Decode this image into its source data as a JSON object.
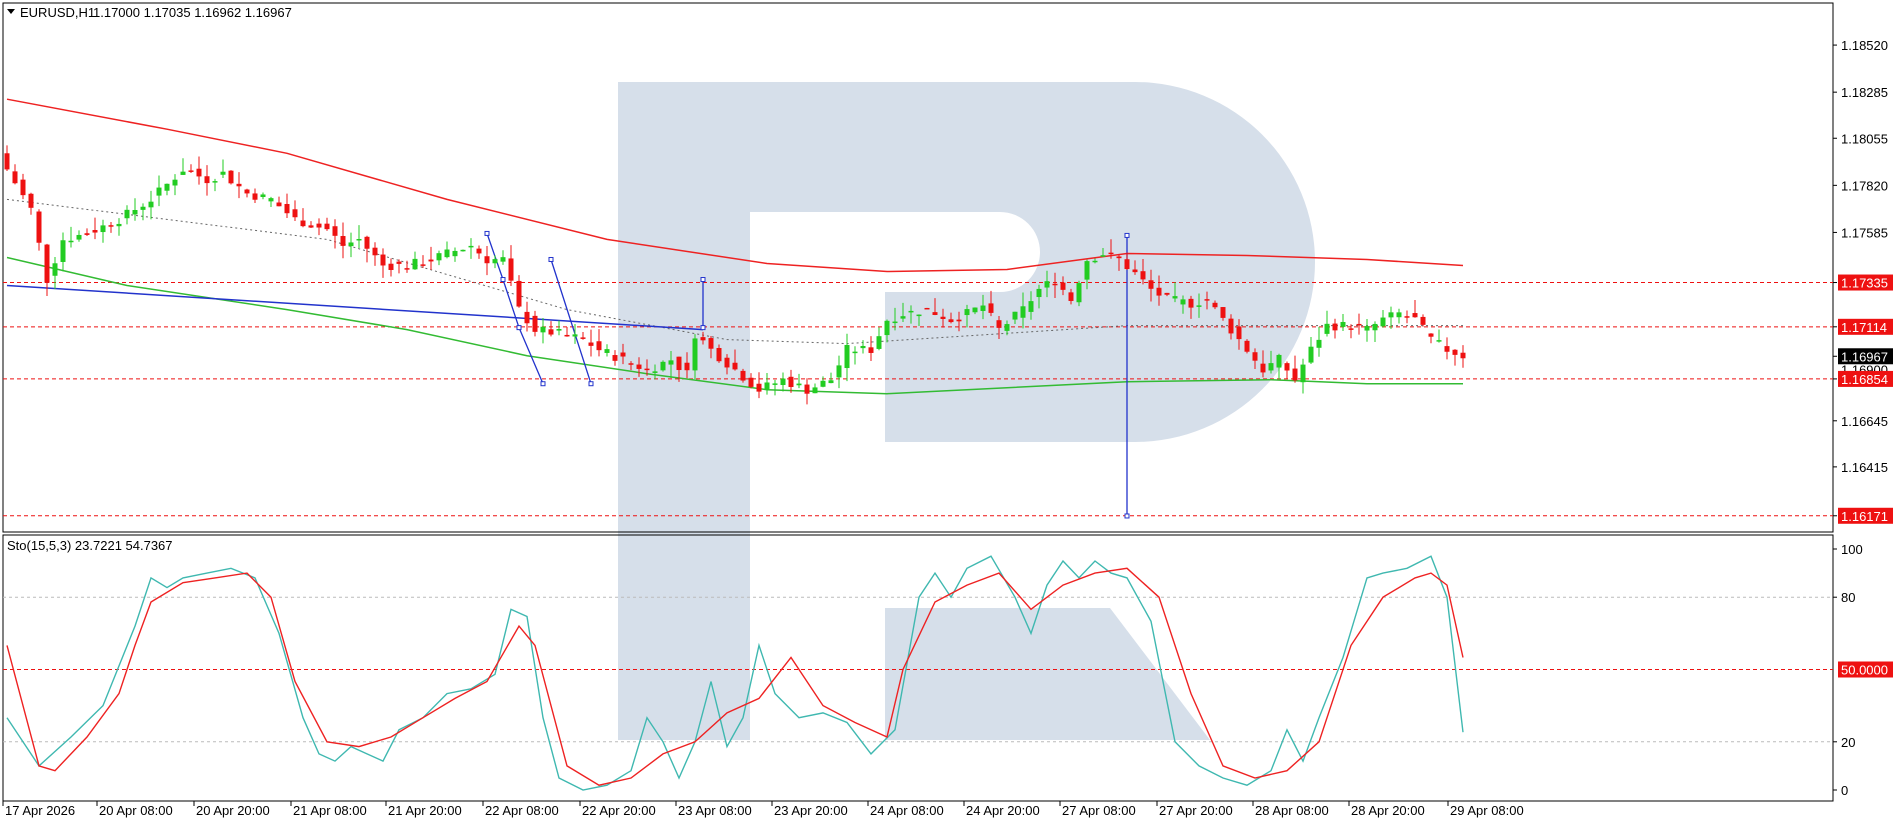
{
  "header": {
    "symbol": "EURUSD,H1",
    "ohlc": "1.17000 1.17035 1.16962 1.16967"
  },
  "stoch_header": "Sto(15,5,3) 23.7221 54.7367",
  "colors": {
    "bull": "#22cc22",
    "bear": "#ee1111",
    "ma_slow": "#ee2222",
    "ma_fast": "#33bb33",
    "trend_blue": "#2233cc",
    "stoch_main": "#3fb8b0",
    "stoch_signal": "#ee2222",
    "level_red": "#ee1111",
    "watermark": "#d6dfea"
  },
  "chart_data": [
    {
      "type": "candlestick",
      "title": "EURUSD,H1",
      "y_ticks": [
        "1.18520",
        "1.18285",
        "1.18055",
        "1.17820",
        "1.17585",
        "1.17335",
        "1.17114",
        "1.16967",
        "1.16854",
        "1.16645",
        "1.16415",
        "1.16171"
      ],
      "x_ticks": [
        "17 Apr 2026",
        "20 Apr 08:00",
        "20 Apr 20:00",
        "21 Apr 08:00",
        "21 Apr 20:00",
        "22 Apr 08:00",
        "22 Apr 20:00",
        "23 Apr 08:00",
        "23 Apr 20:00",
        "24 Apr 08:00",
        "24 Apr 20:00",
        "27 Apr 08:00",
        "27 Apr 20:00",
        "28 Apr 08:00",
        "28 Apr 20:00",
        "29 Apr 08:00"
      ],
      "hidden_tick": "1.16900",
      "ylim": [
        1.161,
        1.1872
      ],
      "price_levels": [
        {
          "value": 1.17335,
          "label": "1.17335"
        },
        {
          "value": 1.17114,
          "label": "1.17114"
        },
        {
          "value": 1.16854,
          "label": "1.16854"
        },
        {
          "value": 1.16171,
          "label": "1.16171"
        }
      ],
      "current_price": {
        "value": 1.16967,
        "label": "1.16967"
      },
      "close_path": [
        [
          0,
          1.179
        ],
        [
          3,
          1.177
        ],
        [
          5,
          1.1735
        ],
        [
          7,
          1.1755
        ],
        [
          10,
          1.1758
        ],
        [
          14,
          1.1765
        ],
        [
          18,
          1.1775
        ],
        [
          22,
          1.179
        ],
        [
          25,
          1.1785
        ],
        [
          27,
          1.1788
        ],
        [
          30,
          1.1778
        ],
        [
          33,
          1.1775
        ],
        [
          36,
          1.1765
        ],
        [
          40,
          1.176
        ],
        [
          42,
          1.1752
        ],
        [
          44,
          1.1755
        ],
        [
          47,
          1.1742
        ],
        [
          50,
          1.1742
        ],
        [
          53,
          1.1745
        ],
        [
          55,
          1.1748
        ],
        [
          58,
          1.1752
        ],
        [
          60,
          1.1745
        ],
        [
          62,
          1.1745
        ],
        [
          64,
          1.172
        ],
        [
          66,
          1.171
        ],
        [
          69,
          1.1708
        ],
        [
          72,
          1.1705
        ],
        [
          74,
          1.17
        ],
        [
          77,
          1.1695
        ],
        [
          80,
          1.169
        ],
        [
          83,
          1.1695
        ],
        [
          85,
          1.1688
        ],
        [
          86,
          1.1708
        ],
        [
          88,
          1.17
        ],
        [
          91,
          1.169
        ],
        [
          94,
          1.168
        ],
        [
          97,
          1.1685
        ],
        [
          100,
          1.168
        ],
        [
          103,
          1.1685
        ],
        [
          105,
          1.17
        ],
        [
          108,
          1.17
        ],
        [
          110,
          1.1715
        ],
        [
          112,
          1.1718
        ],
        [
          115,
          1.172
        ],
        [
          118,
          1.1715
        ],
        [
          120,
          1.1718
        ],
        [
          122,
          1.1722
        ],
        [
          124,
          1.171
        ],
        [
          127,
          1.172
        ],
        [
          129,
          1.173
        ],
        [
          131,
          1.1735
        ],
        [
          133,
          1.1725
        ],
        [
          135,
          1.1745
        ],
        [
          137,
          1.1748
        ],
        [
          139,
          1.1745
        ],
        [
          141,
          1.1738
        ],
        [
          143,
          1.173
        ],
        [
          145,
          1.1725
        ],
        [
          148,
          1.1723
        ],
        [
          150,
          1.1725
        ],
        [
          151,
          1.172
        ],
        [
          153,
          1.171
        ],
        [
          155,
          1.17
        ],
        [
          157,
          1.169
        ],
        [
          159,
          1.1695
        ],
        [
          161,
          1.1685
        ],
        [
          163,
          1.17
        ],
        [
          165,
          1.1712
        ],
        [
          168,
          1.1712
        ],
        [
          170,
          1.171
        ],
        [
          172,
          1.1715
        ],
        [
          174,
          1.1718
        ],
        [
          176,
          1.1715
        ],
        [
          178,
          1.1705
        ],
        [
          180,
          1.17
        ],
        [
          182,
          1.1697
        ]
      ],
      "series": [
        {
          "name": "ma_slow",
          "points": [
            [
              0,
              1.1825
            ],
            [
              20,
              1.181
            ],
            [
              35,
              1.1798
            ],
            [
              55,
              1.1775
            ],
            [
              75,
              1.1755
            ],
            [
              95,
              1.1743
            ],
            [
              110,
              1.1739
            ],
            [
              125,
              1.174
            ],
            [
              140,
              1.1748
            ],
            [
              155,
              1.1747
            ],
            [
              170,
              1.1745
            ],
            [
              182,
              1.1742
            ]
          ]
        },
        {
          "name": "ma_fast",
          "points": [
            [
              0,
              1.1746
            ],
            [
              15,
              1.1732
            ],
            [
              35,
              1.172
            ],
            [
              50,
              1.171
            ],
            [
              65,
              1.1697
            ],
            [
              80,
              1.1688
            ],
            [
              95,
              1.168
            ],
            [
              110,
              1.1678
            ],
            [
              125,
              1.1681
            ],
            [
              140,
              1.1684
            ],
            [
              158,
              1.1685
            ],
            [
              170,
              1.1683
            ],
            [
              182,
              1.1683
            ]
          ]
        },
        {
          "name": "dotted_trend",
          "points": [
            [
              0,
              1.1775
            ],
            [
              40,
              1.1755
            ],
            [
              70,
              1.172
            ],
            [
              90,
              1.1705
            ],
            [
              105,
              1.1703
            ],
            [
              140,
              1.1712
            ],
            [
              182,
              1.1712
            ]
          ]
        },
        {
          "name": "blue_trend",
          "points": [
            [
              0,
              1.1732
            ],
            [
              87,
              1.171
            ]
          ]
        },
        {
          "name": "blue_zigzag",
          "points": [
            [
              60,
              1.1758
            ],
            [
              62,
              1.1735
            ],
            [
              64,
              1.1711
            ],
            [
              67,
              1.1683
            ]
          ]
        },
        {
          "name": "blue_zigzag_2",
          "points": [
            [
              68,
              1.1745
            ],
            [
              73,
              1.1683
            ]
          ]
        },
        {
          "name": "blue_vertical_1",
          "points": [
            [
              87,
              1.1735
            ],
            [
              87,
              1.1711
            ]
          ]
        },
        {
          "name": "blue_vertical_2",
          "points": [
            [
              140,
              1.1757
            ],
            [
              140,
              1.1617
            ]
          ]
        }
      ]
    },
    {
      "type": "line",
      "title": "Sto(15,5,3) 23.7221 54.7367",
      "y_ticks": [
        "100",
        "80",
        "20",
        "0"
      ],
      "levels": [
        {
          "value": 50,
          "label": "50.0000"
        }
      ],
      "ylim": [
        0,
        100
      ],
      "series": [
        {
          "name": "main",
          "points": [
            [
              0,
              30
            ],
            [
              4,
              10
            ],
            [
              8,
              22
            ],
            [
              12,
              35
            ],
            [
              16,
              68
            ],
            [
              18,
              88
            ],
            [
              20,
              84
            ],
            [
              22,
              88
            ],
            [
              25,
              90
            ],
            [
              28,
              92
            ],
            [
              31,
              88
            ],
            [
              34,
              65
            ],
            [
              37,
              30
            ],
            [
              39,
              15
            ],
            [
              41,
              12
            ],
            [
              43,
              18
            ],
            [
              45,
              15
            ],
            [
              47,
              12
            ],
            [
              49,
              25
            ],
            [
              52,
              30
            ],
            [
              55,
              40
            ],
            [
              58,
              42
            ],
            [
              61,
              48
            ],
            [
              63,
              75
            ],
            [
              65,
              72
            ],
            [
              67,
              30
            ],
            [
              69,
              5
            ],
            [
              72,
              0
            ],
            [
              75,
              2
            ],
            [
              78,
              8
            ],
            [
              80,
              30
            ],
            [
              82,
              20
            ],
            [
              84,
              5
            ],
            [
              86,
              20
            ],
            [
              88,
              45
            ],
            [
              90,
              18
            ],
            [
              92,
              30
            ],
            [
              94,
              60
            ],
            [
              96,
              40
            ],
            [
              99,
              30
            ],
            [
              102,
              32
            ],
            [
              105,
              28
            ],
            [
              108,
              15
            ],
            [
              111,
              25
            ],
            [
              114,
              80
            ],
            [
              116,
              90
            ],
            [
              118,
              80
            ],
            [
              120,
              92
            ],
            [
              123,
              97
            ],
            [
              126,
              80
            ],
            [
              128,
              65
            ],
            [
              130,
              85
            ],
            [
              132,
              95
            ],
            [
              134,
              88
            ],
            [
              136,
              95
            ],
            [
              138,
              90
            ],
            [
              140,
              88
            ],
            [
              143,
              70
            ],
            [
              146,
              20
            ],
            [
              149,
              10
            ],
            [
              152,
              5
            ],
            [
              155,
              2
            ],
            [
              158,
              8
            ],
            [
              160,
              25
            ],
            [
              162,
              12
            ],
            [
              164,
              30
            ],
            [
              167,
              55
            ],
            [
              170,
              88
            ],
            [
              172,
              90
            ],
            [
              175,
              92
            ],
            [
              178,
              97
            ],
            [
              180,
              80
            ],
            [
              182,
              24
            ]
          ]
        },
        {
          "name": "signal",
          "points": [
            [
              0,
              60
            ],
            [
              4,
              10
            ],
            [
              6,
              8
            ],
            [
              10,
              22
            ],
            [
              14,
              40
            ],
            [
              16,
              60
            ],
            [
              18,
              78
            ],
            [
              22,
              86
            ],
            [
              26,
              88
            ],
            [
              30,
              90
            ],
            [
              33,
              80
            ],
            [
              36,
              45
            ],
            [
              40,
              20
            ],
            [
              44,
              18
            ],
            [
              48,
              22
            ],
            [
              52,
              30
            ],
            [
              56,
              38
            ],
            [
              60,
              45
            ],
            [
              64,
              68
            ],
            [
              66,
              60
            ],
            [
              70,
              10
            ],
            [
              74,
              2
            ],
            [
              78,
              5
            ],
            [
              82,
              15
            ],
            [
              86,
              20
            ],
            [
              90,
              32
            ],
            [
              94,
              38
            ],
            [
              98,
              55
            ],
            [
              102,
              35
            ],
            [
              106,
              28
            ],
            [
              110,
              22
            ],
            [
              112,
              50
            ],
            [
              116,
              78
            ],
            [
              120,
              85
            ],
            [
              124,
              90
            ],
            [
              128,
              75
            ],
            [
              132,
              85
            ],
            [
              136,
              90
            ],
            [
              140,
              92
            ],
            [
              144,
              80
            ],
            [
              148,
              40
            ],
            [
              152,
              10
            ],
            [
              156,
              5
            ],
            [
              160,
              8
            ],
            [
              164,
              20
            ],
            [
              168,
              60
            ],
            [
              172,
              80
            ],
            [
              176,
              88
            ],
            [
              178,
              90
            ],
            [
              180,
              85
            ],
            [
              182,
              55
            ]
          ]
        }
      ]
    }
  ]
}
